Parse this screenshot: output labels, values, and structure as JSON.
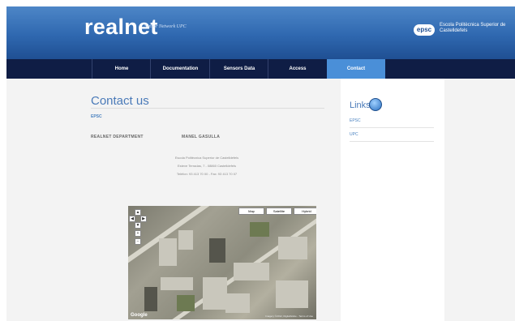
{
  "header": {
    "brand": "realnet",
    "tagline": "Sensor Network UPC",
    "logo_text": "epsc",
    "school_name": "Escola Politècnica Superior de Castelldefels"
  },
  "nav": {
    "items": [
      "Home",
      "Documentation",
      "Sensors Data",
      "Access",
      "Contact"
    ],
    "active": "Contact"
  },
  "main": {
    "title": "Contact us",
    "section_link": "EPSC",
    "department": "REALNET DEPARTMENT",
    "person": "MANEL GASULLA",
    "address": [
      "Escola Politècnica Superior de Castelldefels",
      "Esteve Terradas, 7 - 08860 Castelldefels",
      "Telèfon: 93 413 70 00 - Fax: 93 413 70 07"
    ]
  },
  "map": {
    "buttons": [
      "Map",
      "Satellite",
      "Hybrid"
    ],
    "logo": "Google",
    "copyright": "Imagery ©2012, DigitalGlobe - Terms of Use"
  },
  "sidebar": {
    "title": "Links",
    "links": [
      "EPSC",
      "UPC"
    ]
  }
}
